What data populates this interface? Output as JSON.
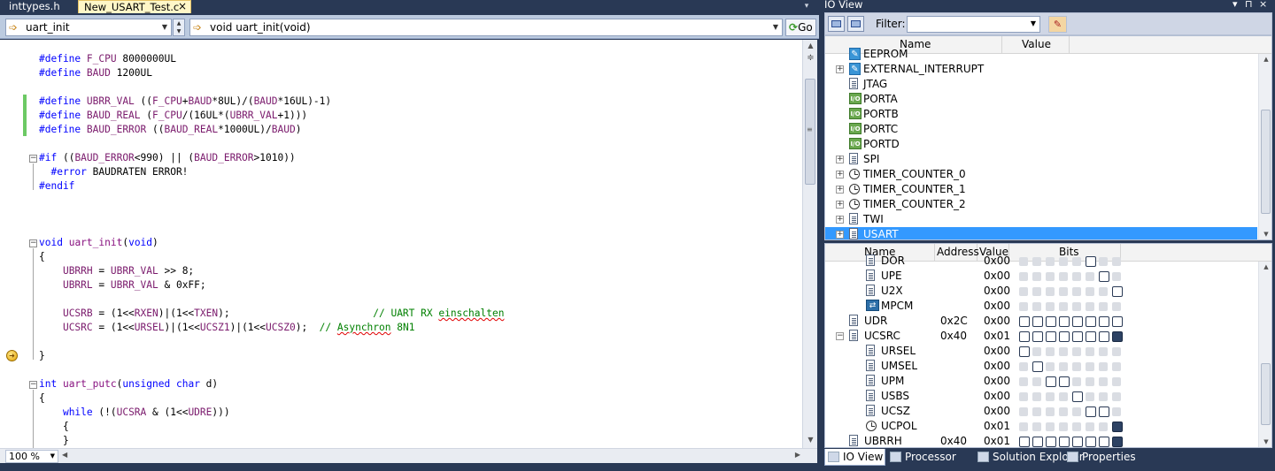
{
  "editor": {
    "tabs": [
      {
        "label": "inttypes.h",
        "active": false
      },
      {
        "label": "New_USART_Test.c",
        "active": true
      }
    ],
    "close_glyph": "×",
    "overflow_glyph": "▾",
    "nav_left": "uart_init",
    "nav_right": "void uart_init(void)",
    "go_label": "Go",
    "zoom": "100 %",
    "code": [
      "#define F_CPU 8000000UL",
      "#define BAUD 1200UL",
      "",
      "#define UBRR_VAL ((F_CPU+BAUD*8UL)/(BAUD*16UL)-1)",
      "#define BAUD_REAL (F_CPU/(16UL*(UBRR_VAL+1)))",
      "#define BAUD_ERROR ((BAUD_REAL*1000UL)/BAUD)",
      "",
      "#if ((BAUD_ERROR<990) || (BAUD_ERROR>1010))",
      "  #error BAUDRATEN ERROR!",
      "#endif",
      "",
      "",
      "",
      "void uart_init(void)",
      "{",
      "    UBRRH = UBRR_VAL >> 8;",
      "    UBRRL = UBRR_VAL & 0xFF;",
      "",
      "    UCSRB = (1<<RXEN)|(1<<TXEN);                        // UART RX einschalten",
      "    UCSRC = (1<<URSEL)|(1<<UCSZ1)|(1<<UCSZ0);  // Asynchron 8N1",
      "",
      "}",
      "",
      "int uart_putc(unsigned char d)",
      "{",
      "    while (!(UCSRA & (1<<UDRE)))",
      "    {",
      "    }"
    ]
  },
  "ioview": {
    "title": "IO View",
    "filter_label": "Filter:",
    "filter_value": "",
    "top_headers": {
      "name": "Name",
      "value": "Value"
    },
    "top_items": [
      {
        "name": "EEPROM",
        "icon": "ext-icon",
        "expandable": false
      },
      {
        "name": "EXTERNAL_INTERRUPT",
        "icon": "ext-icon",
        "expandable": true
      },
      {
        "name": "JTAG",
        "icon": "doc-icon",
        "expandable": false
      },
      {
        "name": "PORTA",
        "icon": "io-icon",
        "expandable": false
      },
      {
        "name": "PORTB",
        "icon": "io-icon",
        "expandable": false
      },
      {
        "name": "PORTC",
        "icon": "io-icon",
        "expandable": false
      },
      {
        "name": "PORTD",
        "icon": "io-icon",
        "expandable": false
      },
      {
        "name": "SPI",
        "icon": "doc-icon",
        "expandable": true
      },
      {
        "name": "TIMER_COUNTER_0",
        "icon": "timer-icon",
        "expandable": true
      },
      {
        "name": "TIMER_COUNTER_1",
        "icon": "timer-icon",
        "expandable": true
      },
      {
        "name": "TIMER_COUNTER_2",
        "icon": "timer-icon",
        "expandable": true
      },
      {
        "name": "TWI",
        "icon": "doc-icon",
        "expandable": true
      },
      {
        "name": "USART",
        "icon": "doc-icon",
        "expandable": true,
        "selected": true
      }
    ],
    "bottom_headers": {
      "name": "Name",
      "address": "Address",
      "value": "Value",
      "bits": "Bits"
    },
    "bottom_items": [
      {
        "name": "DOR",
        "indent": 1,
        "icon": "doc-icon",
        "address": "",
        "value": "0x00",
        "bits": [
          0,
          0,
          0,
          0,
          0,
          2,
          0,
          0
        ]
      },
      {
        "name": "UPE",
        "indent": 1,
        "icon": "doc-icon",
        "address": "",
        "value": "0x00",
        "bits": [
          0,
          0,
          0,
          0,
          0,
          0,
          2,
          0
        ]
      },
      {
        "name": "U2X",
        "indent": 1,
        "icon": "doc-icon",
        "address": "",
        "value": "0x00",
        "bits": [
          0,
          0,
          0,
          0,
          0,
          0,
          0,
          2
        ]
      },
      {
        "name": "MPCM",
        "indent": 1,
        "icon": "mpcm-icon",
        "address": "",
        "value": "0x00",
        "bits": [
          0,
          0,
          0,
          0,
          0,
          0,
          0,
          0,
          2
        ]
      },
      {
        "name": "UDR",
        "indent": 0,
        "icon": "doc-icon",
        "address": "0x2C",
        "value": "0x00",
        "bits": [
          2,
          2,
          2,
          2,
          2,
          2,
          2,
          2
        ]
      },
      {
        "name": "UCSRC",
        "indent": 0,
        "icon": "doc-icon",
        "address": "0x40",
        "value": "0x01",
        "bits": [
          2,
          2,
          2,
          2,
          2,
          2,
          2,
          3
        ],
        "expanded": true
      },
      {
        "name": "URSEL",
        "indent": 1,
        "icon": "doc-icon",
        "address": "",
        "value": "0x00",
        "bits": [
          2,
          0,
          0,
          0,
          0,
          0,
          0,
          0
        ]
      },
      {
        "name": "UMSEL",
        "indent": 1,
        "icon": "doc-icon",
        "address": "",
        "value": "0x00",
        "bits": [
          0,
          2,
          0,
          0,
          0,
          0,
          0,
          0
        ]
      },
      {
        "name": "UPM",
        "indent": 1,
        "icon": "doc-icon",
        "address": "",
        "value": "0x00",
        "bits": [
          0,
          0,
          2,
          2,
          0,
          0,
          0,
          0
        ]
      },
      {
        "name": "USBS",
        "indent": 1,
        "icon": "doc-icon",
        "address": "",
        "value": "0x00",
        "bits": [
          0,
          0,
          0,
          0,
          2,
          0,
          0,
          0
        ]
      },
      {
        "name": "UCSZ",
        "indent": 1,
        "icon": "doc-icon",
        "address": "",
        "value": "0x00",
        "bits": [
          0,
          0,
          0,
          0,
          0,
          2,
          2,
          0
        ]
      },
      {
        "name": "UCPOL",
        "indent": 1,
        "icon": "timer-icon",
        "address": "",
        "value": "0x01",
        "bits": [
          0,
          0,
          0,
          0,
          0,
          0,
          0,
          3
        ]
      },
      {
        "name": "UBRRH",
        "indent": 0,
        "icon": "doc-icon",
        "address": "0x40",
        "value": "0x01",
        "bits": [
          2,
          2,
          2,
          2,
          2,
          2,
          2,
          3
        ]
      }
    ],
    "bottom_tabs": [
      "IO View",
      "Processor",
      "Solution Explorer",
      "Properties"
    ]
  },
  "colors": {
    "background": "#293955",
    "selection": "#3399ff",
    "change_marker": "#6cc964",
    "bit_set": "#2d4263"
  }
}
